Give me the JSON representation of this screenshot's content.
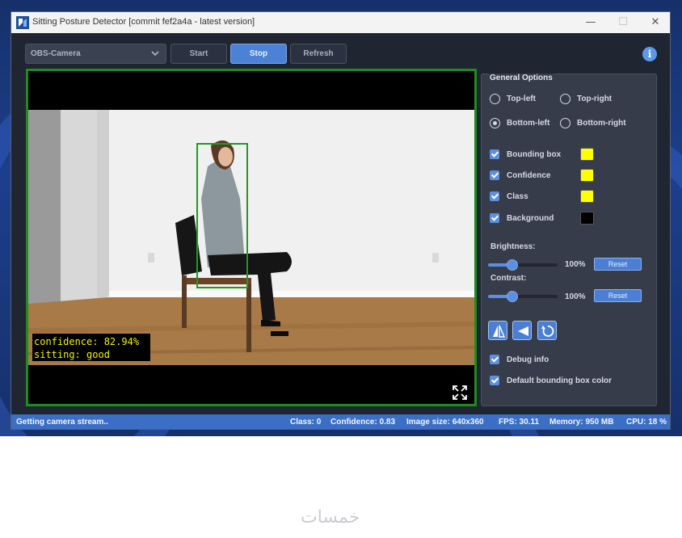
{
  "window": {
    "title": "Sitting Posture Detector [commit fef2a4a - latest version]",
    "minimize_glyph": "—",
    "maximize_glyph": "☐",
    "close_glyph": "✕"
  },
  "toolbar": {
    "camera_select_value": "OBS-Camera",
    "start_label": "Start",
    "stop_label": "Stop",
    "refresh_label": "Refresh",
    "info_glyph": "i",
    "info_icon": "info-icon"
  },
  "video": {
    "overlay_line1": "confidence: 82.94%",
    "overlay_line2": "sitting: good",
    "fullscreen_icon": "expand-icon"
  },
  "options": {
    "title": "General Options",
    "position": {
      "top_left": "Top-left",
      "top_right": "Top-right",
      "bottom_left": "Bottom-left",
      "bottom_right": "Bottom-right",
      "selected": "Bottom-left"
    },
    "draw": {
      "bounding_box": {
        "label": "Bounding box",
        "checked": true,
        "color": "#ffff00"
      },
      "confidence": {
        "label": "Confidence",
        "checked": true,
        "color": "#ffff00"
      },
      "class": {
        "label": "Class",
        "checked": true,
        "color": "#ffff00"
      },
      "background": {
        "label": "Background",
        "checked": true,
        "color": "#000000"
      }
    },
    "brightness": {
      "label": "Brightness:",
      "value_text": "100%",
      "level": 0.35,
      "reset_label": "Reset"
    },
    "contrast": {
      "label": "Contrast:",
      "value_text": "100%",
      "level": 0.35,
      "reset_label": "Reset"
    },
    "transform_buttons": [
      "flip-horizontal-icon",
      "flip-vertical-icon",
      "rotate-icon"
    ],
    "debug_info": {
      "label": "Debug info",
      "checked": true
    },
    "default_bbox_color": {
      "label": "Default bounding box color",
      "checked": true
    }
  },
  "status": {
    "message": "Getting camera stream..",
    "class": "Class: 0",
    "confidence": "Confidence: 0.83",
    "image_size": "Image size: 640x360",
    "fps": "FPS: 30.11",
    "memory": "Memory: 950 MB",
    "cpu": "CPU: 18 %"
  },
  "watermark": "خمسات",
  "colors": {
    "accent": "#4c82d6",
    "status_bar": "#3b6fc6",
    "video_border": "#1f8c1f",
    "overlay_text": "#f5f000"
  }
}
